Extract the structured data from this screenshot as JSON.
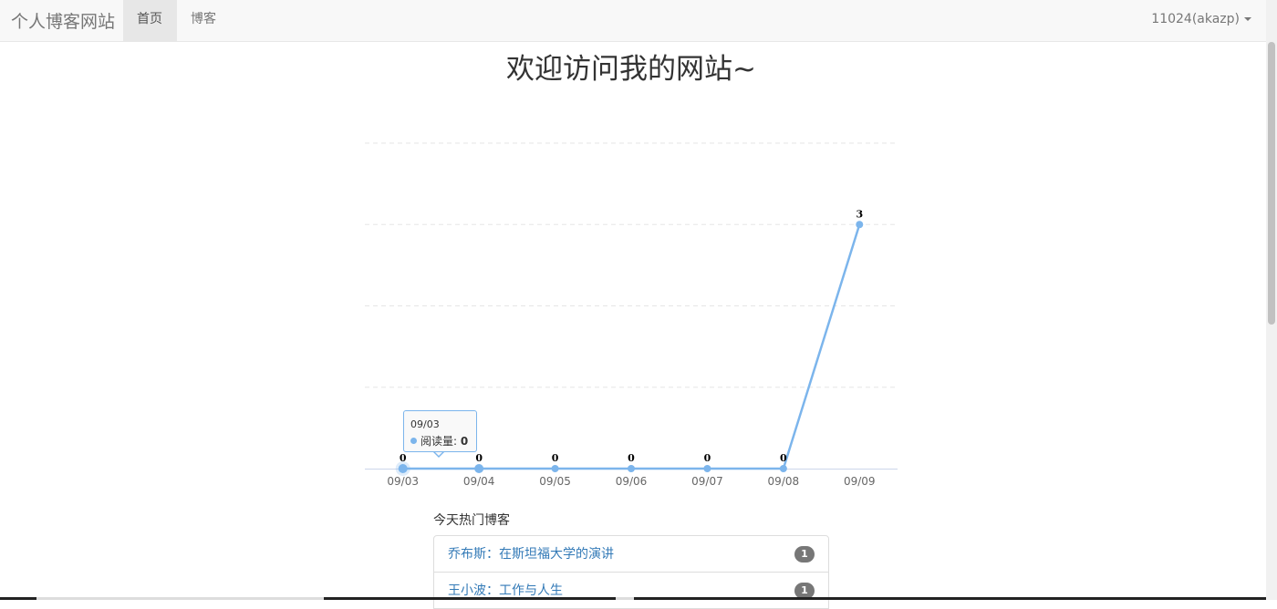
{
  "navbar": {
    "brand": "个人博客网站",
    "items": [
      {
        "label": "首页",
        "active": true
      },
      {
        "label": "博客",
        "active": false
      }
    ],
    "user": "11024(akazp)"
  },
  "page_title": "欢迎访问我的网站~",
  "chart_data": {
    "type": "line",
    "categories": [
      "09/03",
      "09/04",
      "09/05",
      "09/06",
      "09/07",
      "09/08",
      "09/09"
    ],
    "series": [
      {
        "name": "阅读量",
        "values": [
          0,
          0,
          0,
          0,
          0,
          0,
          3
        ],
        "color": "#7cb5ec"
      }
    ],
    "data_labels": [
      "0",
      "0",
      "0",
      "0",
      "0",
      "0",
      "3"
    ],
    "ylim": [
      0,
      4
    ],
    "grid": true,
    "legend": "none",
    "tooltip": {
      "category": "09/03",
      "series": "阅读量",
      "value": "0"
    }
  },
  "hot_blogs": {
    "title": "今天热门博客",
    "items": [
      {
        "title": "乔布斯：在斯坦福大学的演讲",
        "count": "1"
      },
      {
        "title": "王小波：工作与人生",
        "count": "1"
      }
    ]
  }
}
